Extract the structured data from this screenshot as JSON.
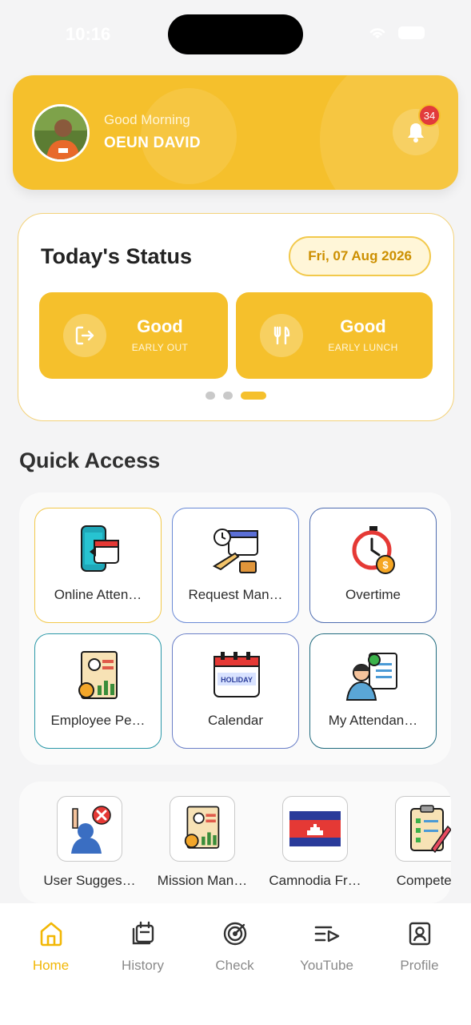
{
  "status_bar": {
    "time": "10:16"
  },
  "header": {
    "greeting": "Good Morning",
    "user_name": "OEUN DAVID",
    "notification_count": "34",
    "accent_color": "#f5c02c"
  },
  "today_status": {
    "title": "Today's Status",
    "date": "Fri, 07 Aug 2026",
    "cards": [
      {
        "value": "Good",
        "label": "EARLY OUT",
        "icon": "logout-icon"
      },
      {
        "value": "Good",
        "label": "EARLY LUNCH",
        "icon": "fork-knife-icon"
      }
    ],
    "pager": {
      "total": 3,
      "active": 3
    }
  },
  "quick_access": {
    "title": "Quick Access",
    "tiles": [
      {
        "label": "Online Atten…",
        "icon": "phone-calendar-icon",
        "border": "#f2c94c"
      },
      {
        "label": "Request Man…",
        "icon": "travel-calendar-icon",
        "border": "#6a8ad6"
      },
      {
        "label": "Overtime",
        "icon": "stopwatch-dollar-icon",
        "border": "#4f6db0"
      },
      {
        "label": "Employee Pe…",
        "icon": "performance-report-icon",
        "border": "#2a98a8"
      },
      {
        "label": "Calendar",
        "icon": "holiday-calendar-icon",
        "border": "#6a7fc7"
      },
      {
        "label": "My Attendan…",
        "icon": "attendance-checklist-icon",
        "border": "#1f6a7e"
      }
    ]
  },
  "more_apps": [
    {
      "label": "User Sugges…",
      "icon": "user-suggestion-icon"
    },
    {
      "label": "Mission Man…",
      "icon": "mission-report-icon"
    },
    {
      "label": "Camnodia Fr…",
      "icon": "cambodia-flag-icon"
    },
    {
      "label": "Competen",
      "icon": "clipboard-checklist-icon"
    }
  ],
  "bottom_nav": [
    {
      "label": "Home",
      "icon": "home-icon",
      "active": true
    },
    {
      "label": "History",
      "icon": "history-icon",
      "active": false
    },
    {
      "label": "Check",
      "icon": "target-check-icon",
      "active": false
    },
    {
      "label": "YouTube",
      "icon": "playlist-play-icon",
      "active": false
    },
    {
      "label": "Profile",
      "icon": "profile-icon",
      "active": false
    }
  ]
}
